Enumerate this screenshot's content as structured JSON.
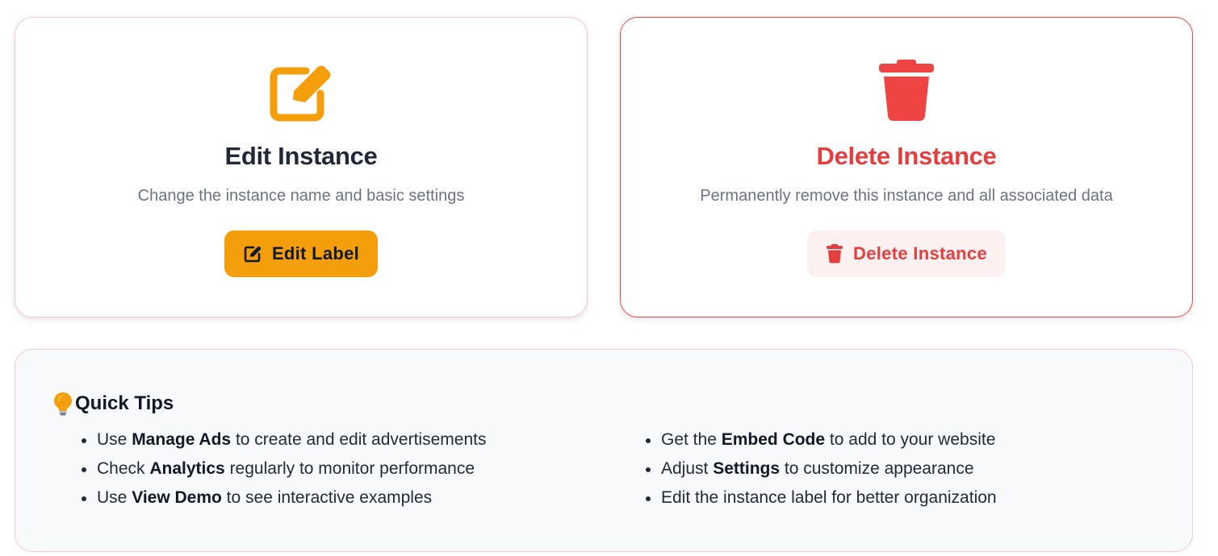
{
  "colors": {
    "accent_amber": "#f59e0b",
    "danger_red": "#ef4444",
    "danger_bg": "#fdf0f0",
    "muted_text": "#6b7280",
    "tips_bg": "#f8f9fb"
  },
  "edit_card": {
    "icon": "edit-square-icon",
    "title": "Edit Instance",
    "description": "Change the instance name and basic settings",
    "button": {
      "icon": "edit-square-icon",
      "label": "Edit Label"
    }
  },
  "delete_card": {
    "icon": "trash-icon",
    "title": "Delete Instance",
    "description": "Permanently remove this instance and all associated data",
    "button": {
      "icon": "trash-icon",
      "label": "Delete Instance"
    }
  },
  "tips": {
    "icon": "lightbulb-icon",
    "title": "Quick Tips",
    "left": [
      {
        "pre": "Use ",
        "bold": "Manage Ads",
        "post": " to create and edit advertisements"
      },
      {
        "pre": "Check ",
        "bold": "Analytics",
        "post": " regularly to monitor performance"
      },
      {
        "pre": "Use ",
        "bold": "View Demo",
        "post": " to see interactive examples"
      }
    ],
    "right": [
      {
        "pre": "Get the ",
        "bold": "Embed Code",
        "post": " to add to your website"
      },
      {
        "pre": "Adjust ",
        "bold": "Settings",
        "post": " to customize appearance"
      },
      {
        "pre": "Edit the instance label for better organization",
        "bold": "",
        "post": ""
      }
    ]
  }
}
